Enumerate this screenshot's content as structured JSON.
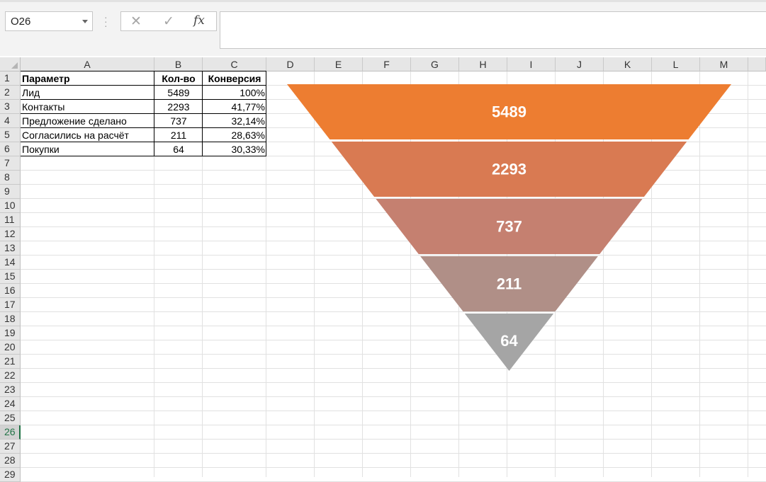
{
  "formula_bar": {
    "name_box": "O26",
    "cancel_icon": "✕",
    "enter_icon": "✓",
    "fx_label": "fx",
    "formula_value": ""
  },
  "columns": [
    "A",
    "B",
    "C",
    "D",
    "E",
    "F",
    "G",
    "H",
    "I",
    "J",
    "K",
    "L",
    "M"
  ],
  "rows": [
    "1",
    "2",
    "3",
    "4",
    "5",
    "6",
    "7",
    "8",
    "9",
    "10",
    "11",
    "12",
    "13",
    "14",
    "15",
    "16",
    "17",
    "18",
    "19",
    "20",
    "21",
    "22",
    "23",
    "24",
    "25",
    "26",
    "27",
    "28",
    "29"
  ],
  "active_row": "26",
  "table": {
    "headers": [
      "Параметр",
      "Кол-во",
      "Конверсия"
    ],
    "rows": [
      [
        "Лид",
        "5489",
        "100%"
      ],
      [
        "Контакты",
        "2293",
        "41,77%"
      ],
      [
        "Предложение сделано",
        "737",
        "32,14%"
      ],
      [
        "Согласились на расчёт",
        "211",
        "28,63%"
      ],
      [
        "Покупки",
        "64",
        "30,33%"
      ]
    ]
  },
  "chart_data": {
    "type": "funnel",
    "categories": [
      "Лид",
      "Контакты",
      "Предложение сделано",
      "Согласились на расчёт",
      "Покупки"
    ],
    "values": [
      5489,
      2293,
      737,
      211,
      64
    ],
    "data_labels": [
      "5489",
      "2293",
      "737",
      "211",
      "64"
    ],
    "colors": [
      "#ed7d31",
      "#d97a52",
      "#c58070",
      "#b08f87",
      "#a5a5a5"
    ],
    "title": "",
    "legend": "none"
  }
}
